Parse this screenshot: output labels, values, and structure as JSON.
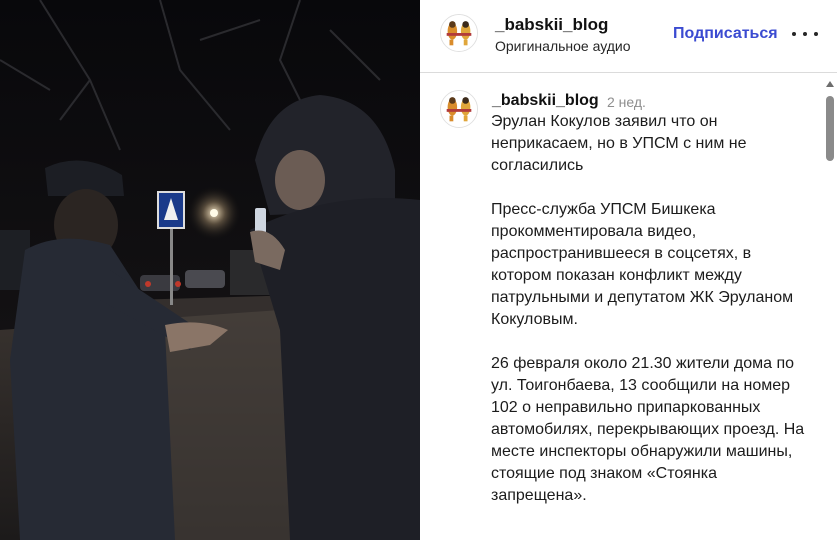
{
  "header": {
    "username": "_babskii_blog",
    "audio": "Оригинальное аудио",
    "follow_label": "Подписаться",
    "more_icon": "more-horizontal-icon"
  },
  "caption": {
    "username": "_babskii_blog",
    "time": "2 нед.",
    "paragraphs": [
      "Эрулан Кокулов заявил что он неприкасаем, но в УПСМ с ним не согласились",
      "Пресс-служба УПСМ Бишкека прокомментировала видео, распространившееся в соцсетях, в котором показан конфликт между патрульными и депутатом ЖК Эруланом Кокуловым.",
      "26 февраля около 21.30 жители дома по ул. Тоигонбаева, 13 сообщили на номер 102 о неправильно припаркованных автомобилях, перекрывающих проезд. На месте инспекторы обнаружили машины, стоящие под знаком «Стоянка запрещена»."
    ]
  },
  "colors": {
    "follow": "#3b4bd1",
    "time": "#8e8e8e",
    "border": "#dbdbdb"
  }
}
